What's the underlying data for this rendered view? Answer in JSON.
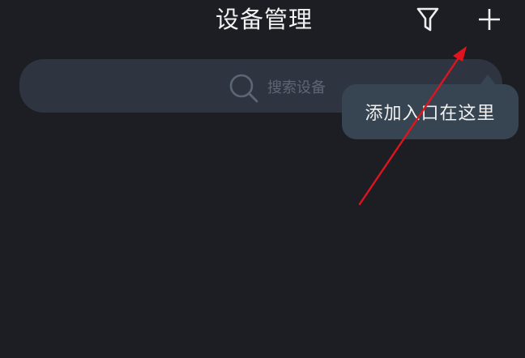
{
  "header": {
    "title": "设备管理",
    "filter_icon": "filter-icon",
    "add_icon": "plus-icon"
  },
  "search": {
    "icon": "search-icon",
    "placeholder": "搜索设备"
  },
  "tooltip": {
    "text": "添加入口在这里"
  },
  "annotation": {
    "arrow_color": "#e0141e"
  },
  "colors": {
    "background": "#1c1e23",
    "search_bg": "#2e3540",
    "tooltip_bg": "#374452"
  }
}
